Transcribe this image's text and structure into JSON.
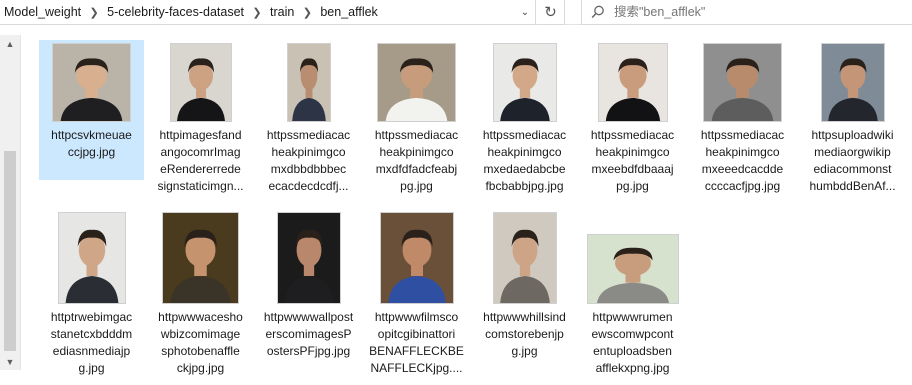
{
  "breadcrumb": [
    "Model_weight",
    "5-celebrity-faces-dataset",
    "train",
    "ben_afflek"
  ],
  "search": {
    "placeholder": "搜索\"ben_afflek\""
  },
  "icons": {
    "separator": "chevron-right-icon",
    "dropdown": "chevron-down-icon",
    "refresh": "refresh-icon",
    "search": "search-icon"
  },
  "files": [
    {
      "label": "httpcsvkmeuae\nccjpg.jpg",
      "selected": true,
      "bg": "#b9b3a8",
      "skin": "#d8b08f",
      "shirt": "#1f1f22"
    },
    {
      "label": "httpimagesfand\nangocomrImag\neRendererrede\nsignstaticimgn...",
      "bg": "#d9d6d0",
      "skin": "#cda283",
      "shirt": "#151518"
    },
    {
      "label": "httpssmediacac\nheakpinimgco\nmxdbbdbbbec\necacdecdcdfj...",
      "bg": "#c9c2b4",
      "skin": "#b88d70",
      "shirt": "#2c3446"
    },
    {
      "label": "httpssmediacac\nheakpinimgco\nmxdfdfadcfeabj\npg.jpg",
      "bg": "#a69a88",
      "skin": "#c79c7c",
      "shirt": "#f2f2ee"
    },
    {
      "label": "httpssmediacac\nheakpinimgco\nmxedaedabcbe\nfbcbabbjpg.jpg",
      "bg": "#e9e9e8",
      "skin": "#d2a888",
      "shirt": "#1e232b"
    },
    {
      "label": "httpssmediacac\nheakpinimgco\nmxeebdfdbaaaj\npg.jpg",
      "bg": "#e8e4df",
      "skin": "#c99c7e",
      "shirt": "#121214"
    },
    {
      "label": "httpssmediacac\nheakpinimgco\nmxeeedcacdde\nccccacfjpg.jpg",
      "bg": "#8f8f8f",
      "skin": "#b88b6c",
      "shirt": "#5d5d5e"
    },
    {
      "label": "httpsuploadwiki\nmediaorgwikip\nediacommonst\nhumbddBenAf...",
      "bg": "#7f8b97",
      "skin": "#c49677",
      "shirt": "#23262c"
    },
    {
      "label": "httptrwebimgac\nstanetcxbdddm\nediasnmediajp\ng.jpg",
      "bg": "#e6e6e4",
      "skin": "#d0a688",
      "shirt": "#2a2d34"
    },
    {
      "label": "httpwwwacesho\nwbizcomimage\nsphotobenaffle\nckjpg.jpg",
      "bg": "#4a3a1e",
      "skin": "#c5946f",
      "shirt": "#3a3328"
    },
    {
      "label": "httpwwwwallpost\nerscomimagesP\nostersPFjpg.jpg",
      "bg": "#1b1b1c",
      "skin": "#b9876b",
      "shirt": "#1e1e20"
    },
    {
      "label": "httpwwwfilmsco\nopitcgibinattori\nBENAFFLECKBE\nNAFFLECKjpg....",
      "bg": "#6a5038",
      "skin": "#c08a68",
      "shirt": "#2f4fa3"
    },
    {
      "label": "httpwwwhillsind\ncomstorebenjp\ng.jpg",
      "bg": "#cfc9c0",
      "skin": "#cea486",
      "shirt": "#6d6862"
    },
    {
      "label": "httpwwwrumen\newscomwpcont\nentuploadsben\nafflekxpng.jpg",
      "bg": "#d7e2ce",
      "skin": "#c79d7d",
      "shirt": "#8a8a86"
    }
  ]
}
